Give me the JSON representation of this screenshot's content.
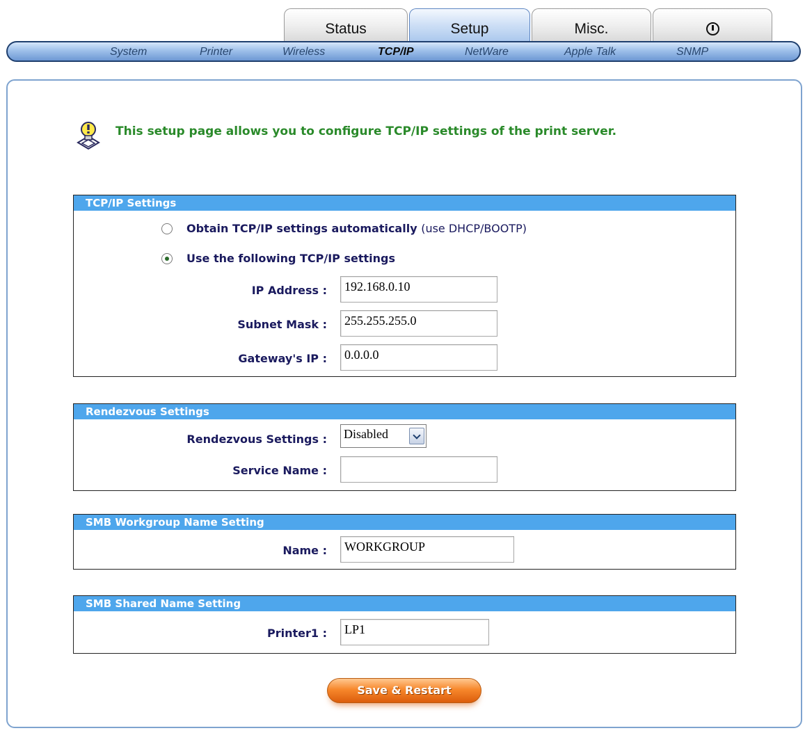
{
  "tabs": [
    {
      "label": "Status",
      "active": false
    },
    {
      "label": "Setup",
      "active": true
    },
    {
      "label": "Misc.",
      "active": false
    },
    {
      "label": "",
      "icon": "power-icon",
      "active": false
    }
  ],
  "subnav": [
    {
      "label": "System",
      "active": false
    },
    {
      "label": "Printer",
      "active": false
    },
    {
      "label": "Wireless",
      "active": false
    },
    {
      "label": "TCP/IP",
      "active": true
    },
    {
      "label": "NetWare",
      "active": false
    },
    {
      "label": "Apple Talk",
      "active": false
    },
    {
      "label": "SNMP",
      "active": false
    }
  ],
  "intro": "This setup page allows you to configure TCP/IP settings of the print server.",
  "tcpip": {
    "title": "TCP/IP Settings",
    "auto_option": "Obtain TCP/IP settings automatically",
    "auto_note": "(use DHCP/BOOTP)",
    "manual_option": "Use the following TCP/IP settings",
    "selected": "manual",
    "ip_label": "IP Address :",
    "ip_value": "192.168.0.10",
    "mask_label": "Subnet Mask :",
    "mask_value": "255.255.255.0",
    "gateway_label": "Gateway's IP :",
    "gateway_value": "0.0.0.0"
  },
  "rendezvous": {
    "title": "Rendezvous Settings",
    "settings_label": "Rendezvous Settings :",
    "settings_value": "Disabled",
    "service_label": "Service Name :",
    "service_value": ""
  },
  "smb_workgroup": {
    "title": "SMB Workgroup Name Setting",
    "name_label": "Name :",
    "name_value": "WORKGROUP"
  },
  "smb_shared": {
    "title": "SMB Shared Name Setting",
    "printer_label": "Printer1 :",
    "printer_value": "LP1"
  },
  "save_button": "Save & Restart",
  "colors": {
    "section_header": "#4ea6ec",
    "intro_text": "#2a8a2a",
    "label_text": "#1a1a5e",
    "save_button": "#f7882c"
  }
}
